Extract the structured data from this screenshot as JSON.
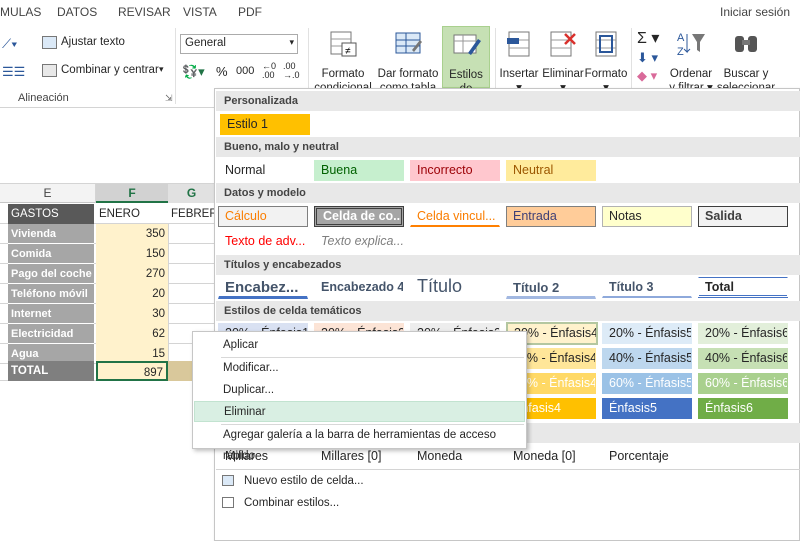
{
  "tabs": [
    "MULAS",
    "DATOS",
    "REVISAR",
    "VISTA",
    "PDF"
  ],
  "signin": "Iniciar sesión",
  "ribbon": {
    "ajustar_texto": "Ajustar texto",
    "combinar_centrar": "Combinar y centrar",
    "alineacion": "Alineación",
    "number_format": "General",
    "percent": "%",
    "thousands": "000",
    "formato_condicional": [
      "Formato",
      "condicional"
    ],
    "dar_formato_tabla": [
      "Dar formato",
      "como tabla"
    ],
    "estilos_celda": [
      "Estilos de",
      "celda"
    ],
    "insertar": "Insertar",
    "eliminar": "Eliminar",
    "formato": "Formato",
    "ordenar_filtrar": [
      "Ordenar",
      "y filtrar"
    ],
    "buscar_seleccionar": [
      "Buscar y",
      "seleccionar"
    ]
  },
  "sheet": {
    "col_e": "E",
    "col_f": "F",
    "col_g": "G",
    "hdr_gastos": "GASTOS",
    "hdr_enero": "ENERO",
    "hdr_febrero": "FEBRERO",
    "rows": [
      {
        "label": "Vivienda",
        "value": "350"
      },
      {
        "label": "Comida",
        "value": "150"
      },
      {
        "label": "Pago del coche",
        "value": "270"
      },
      {
        "label": "Teléfono móvil",
        "value": "20"
      },
      {
        "label": "Internet",
        "value": "30"
      },
      {
        "label": "Electricidad",
        "value": "62"
      },
      {
        "label": "Agua",
        "value": "15"
      }
    ],
    "total_label": "TOTAL",
    "total_value": "897"
  },
  "panel": {
    "sec_personalizada": "Personalizada",
    "estilo1": "Estilo 1",
    "sec_bueno": "Bueno, malo y neutral",
    "normal": "Normal",
    "buena": "Buena",
    "incorrecto": "Incorrecto",
    "neutral": "Neutral",
    "sec_datos": "Datos y modelo",
    "calculo": "Cálculo",
    "celda_comprobacion": "Celda de co...",
    "celda_vinculada": "Celda vincul...",
    "entrada": "Entrada",
    "notas": "Notas",
    "salida": "Salida",
    "texto_advertencia": "Texto de adv...",
    "texto_explicativo": "Texto explica...",
    "sec_titulos": "Títulos y encabezados",
    "encabezado1": "Encabez...",
    "encabezado4": "Encabezado 4",
    "titulo": "Título",
    "titulo2": "Título 2",
    "titulo3": "Título 3",
    "total": "Total",
    "sec_tematicos": "Estilos de celda temáticos",
    "row20": [
      "20% - Énfasis1",
      "20% - Énfasis2",
      "20% - Énfasis3",
      "20% - Énfasis4",
      "20% - Énfasis5",
      "20% - Énfasis6"
    ],
    "row40": [
      "40% - Énfasis4",
      "40% - Énfasis5",
      "40% - Énfasis6"
    ],
    "row60": [
      "60% - Énfasis4",
      "60% - Énfasis5",
      "60% - Énfasis6"
    ],
    "rowE": [
      "Énfasis4",
      "Énfasis5",
      "Énfasis6"
    ],
    "millares": "Millares",
    "millares0": "Millares [0]",
    "moneda": "Moneda",
    "moneda0": "Moneda [0]",
    "porcentaje": "Porcentaje",
    "nuevo_estilo": "Nuevo estilo de celda...",
    "combinar_estilos": "Combinar estilos..."
  },
  "context_menu": {
    "aplicar": "Aplicar",
    "modificar": "Modificar...",
    "duplicar": "Duplicar...",
    "eliminar": "Eliminar",
    "agregar_galeria": "Agregar galería a la barra de herramientas de acceso rápido"
  },
  "colors": {
    "excel_green": "#217346",
    "selected_ribbon": "#c6e0b4",
    "estilo1": "#ffc000"
  }
}
